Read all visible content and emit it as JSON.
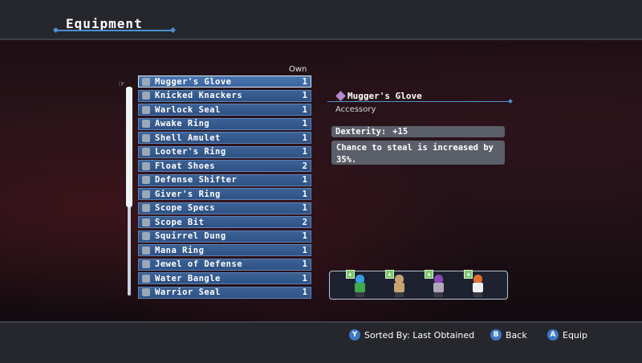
{
  "header": {
    "title": "Equipment"
  },
  "list": {
    "own_label": "Own",
    "items": [
      {
        "name": "Mugger's Glove",
        "count": "1",
        "icon": "glove-icon"
      },
      {
        "name": "Knicked Knackers",
        "count": "1",
        "icon": "knackers-icon"
      },
      {
        "name": "Warlock Seal",
        "count": "1",
        "icon": "seal-icon"
      },
      {
        "name": "Awake Ring",
        "count": "1",
        "icon": "ring-icon"
      },
      {
        "name": "Shell Amulet",
        "count": "1",
        "icon": "amulet-icon"
      },
      {
        "name": "Looter's Ring",
        "count": "1",
        "icon": "ring-icon"
      },
      {
        "name": "Float Shoes",
        "count": "2",
        "icon": "shoes-icon"
      },
      {
        "name": "Defense Shifter",
        "count": "1",
        "icon": "shifter-icon"
      },
      {
        "name": "Giver's Ring",
        "count": "1",
        "icon": "ring-icon"
      },
      {
        "name": "Scope Specs",
        "count": "1",
        "icon": "specs-icon"
      },
      {
        "name": "Scope Bit",
        "count": "2",
        "icon": "bit-icon"
      },
      {
        "name": "Squirrel Dung",
        "count": "1",
        "icon": "dung-icon"
      },
      {
        "name": "Mana Ring",
        "count": "1",
        "icon": "ring-icon"
      },
      {
        "name": "Jewel of Defense",
        "count": "1",
        "icon": "jewel-icon"
      },
      {
        "name": "Water Bangle",
        "count": "1",
        "icon": "bangle-icon"
      },
      {
        "name": "Warrior Seal",
        "count": "1",
        "icon": "seal-icon"
      }
    ],
    "selected_index": 0
  },
  "detail": {
    "name": "Mugger's Glove",
    "type": "Accessory",
    "stat_label": "Dexterity:",
    "stat_value": "+15",
    "description": "Chance to steal is increased by 35%."
  },
  "party": [
    {
      "hair": "#3a9ee0",
      "body": "#3fa84a"
    },
    {
      "hair": "#c8a470",
      "body": "#c8a470"
    },
    {
      "hair": "#8a4ab8",
      "body": "#b0a8b8"
    },
    {
      "hair": "#e07030",
      "body": "#f0f0f0"
    }
  ],
  "footer": {
    "sort": {
      "button": "Y",
      "label": "Sorted By: Last Obtained"
    },
    "back": {
      "button": "B",
      "label": "Back"
    },
    "equip": {
      "button": "A",
      "label": "Equip"
    }
  }
}
